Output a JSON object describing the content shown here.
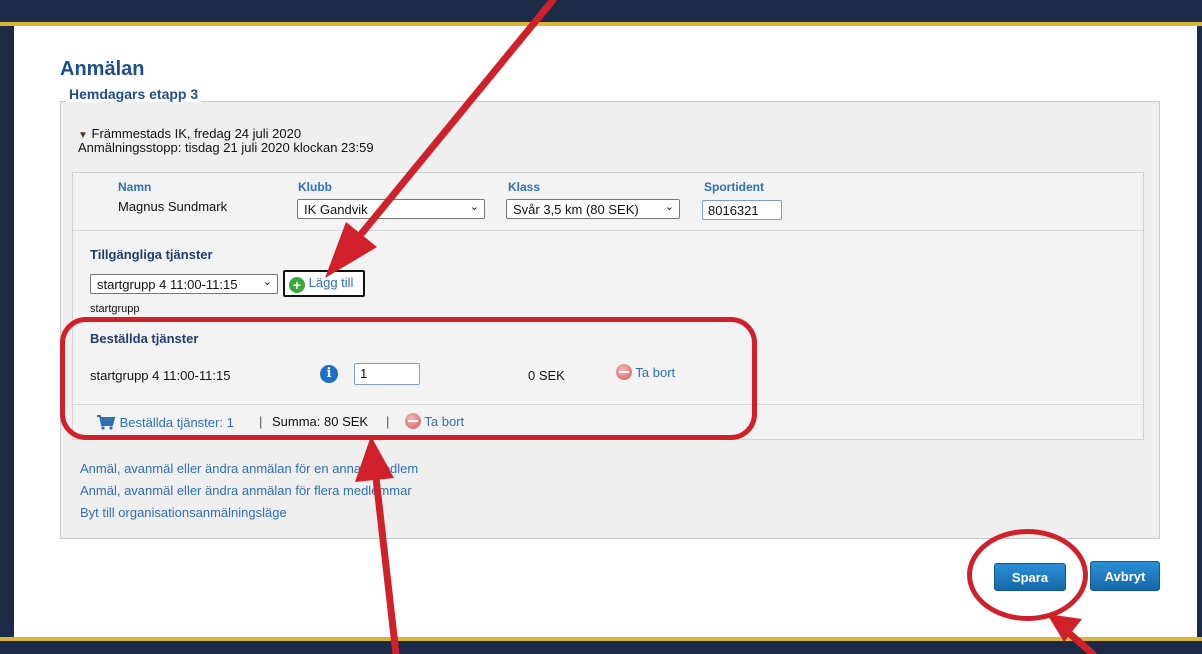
{
  "page": {
    "title": "Anmälan"
  },
  "event": {
    "legend": "Hemdagars etapp 3",
    "details": "Främmestads IK, fredag 24 juli 2020",
    "deadline": "Anmälningsstopp: tisdag 21 juli 2020 klockan 23:59"
  },
  "entry": {
    "headers": {
      "name": "Namn",
      "club": "Klubb",
      "class": "Klass",
      "sportident": "Sportident"
    },
    "name": "Magnus Sundmark",
    "club": "IK Gandvik",
    "class": "Svår 3,5 km (80 SEK)",
    "sportident": "8016321"
  },
  "available_services": {
    "heading": "Tillgängliga tjänster",
    "selected": "startgrupp 4 11:00-11:15",
    "add_label": "Lägg till",
    "caption": "startgrupp"
  },
  "ordered_services": {
    "heading": "Beställda tjänster",
    "rows": [
      {
        "name": "startgrupp 4 11:00-11:15",
        "quantity": "1",
        "price": "0 SEK",
        "remove_label": "Ta bort"
      }
    ],
    "summary": {
      "count_label": "Beställda tjänster: 1",
      "sep1": "|",
      "total": "Summa: 80 SEK",
      "sep2": "|",
      "remove_label": "Ta bort"
    }
  },
  "links": [
    "Anmäl, avanmäl eller ändra anmälan för en annan medlem",
    "Anmäl, avanmäl eller ändra anmälan för flera medlemmar",
    "Byt till organisationsanmälningsläge"
  ],
  "buttons": {
    "save": "Spara",
    "cancel": "Avbryt"
  },
  "icons": {
    "expand": "triangle-down-icon",
    "add": "plus-circle-icon",
    "info": "info-icon",
    "remove": "remove-circle-icon",
    "cart": "cart-icon"
  },
  "colors": {
    "annotation": "#d0202a",
    "primary_button": "#1b7fc4",
    "link": "#2f6fb3",
    "heading": "#1f4e8c"
  }
}
